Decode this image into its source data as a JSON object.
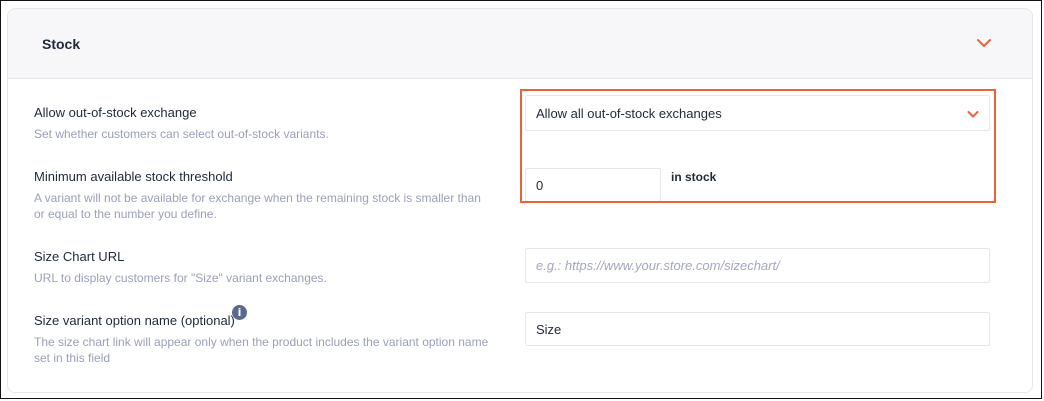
{
  "section": {
    "title": "Stock"
  },
  "icons": {
    "collapse": "chevron-down-icon",
    "select": "chevron-down-icon",
    "info": "info-icon",
    "accent_color": "#e8643a"
  },
  "fields": {
    "exchange": {
      "label": "Allow out-of-stock exchange",
      "description": "Set whether customers can select out-of-stock variants.",
      "selected_value": "Allow all out-of-stock exchanges"
    },
    "threshold": {
      "label": "Minimum available stock threshold",
      "description_line1": "A variant will not be available for exchange when the remaining stock is smaller than",
      "description_line2": "or equal to the number you define.",
      "value": "0",
      "unit": "in stock"
    },
    "size_chart": {
      "label": "Size Chart URL",
      "description": "URL to display customers for \"Size\" variant exchanges.",
      "placeholder": "e.g.: https://www.your.store.com/sizechart/",
      "value": ""
    },
    "size_option": {
      "label": "Size variant option name (optional)",
      "info_glyph": "i",
      "description_line1": "The size chart link will appear only when the product includes the variant option name",
      "description_line2": "set in this field",
      "value": "Size"
    }
  }
}
